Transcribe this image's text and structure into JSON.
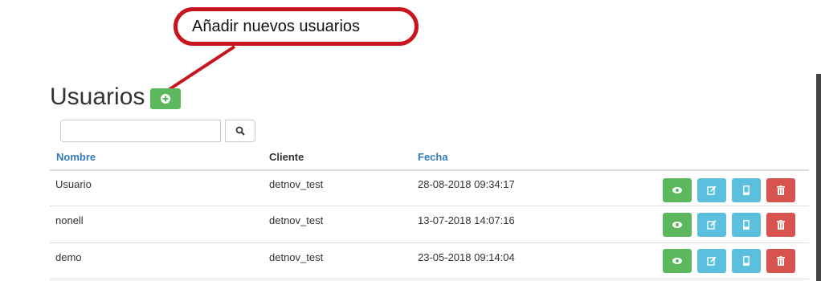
{
  "callout": {
    "text": "Añadir nuevos usuarios"
  },
  "page": {
    "title": "Usuarios"
  },
  "search": {
    "placeholder": ""
  },
  "table": {
    "headers": {
      "nombre": "Nombre",
      "cliente": "Cliente",
      "fecha": "Fecha"
    },
    "rows": [
      {
        "nombre": "Usuario",
        "cliente": "detnov_test",
        "fecha": "28-08-2018 09:34:17"
      },
      {
        "nombre": "nonell",
        "cliente": "detnov_test",
        "fecha": "13-07-2018 14:07:16"
      },
      {
        "nombre": "demo",
        "cliente": "detnov_test",
        "fecha": "23-05-2018 09:14:04"
      }
    ]
  },
  "icons": {
    "add": "plus-circle-icon",
    "search": "search-icon",
    "view": "eye-icon",
    "edit": "edit-icon",
    "device": "mobile-icon",
    "delete": "trash-icon"
  },
  "colors": {
    "green": "#5cb85c",
    "info": "#5bc0de",
    "danger": "#d9534f",
    "link": "#337ab7",
    "callout_border": "#c8141e"
  }
}
